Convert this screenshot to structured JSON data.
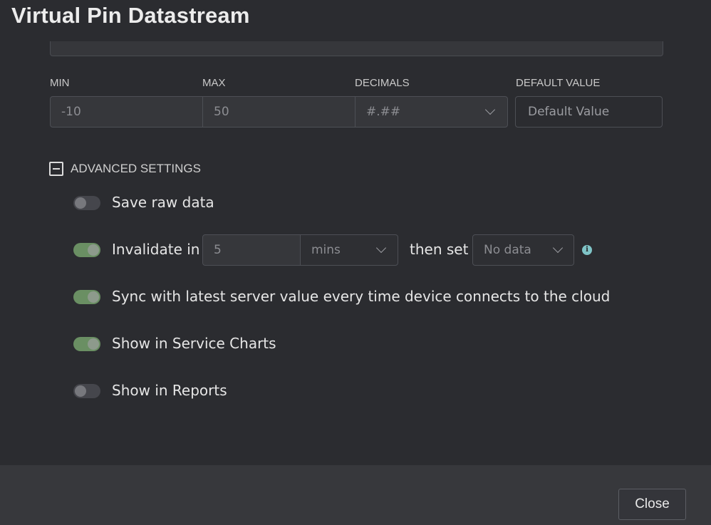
{
  "dialog": {
    "title": "Virtual Pin Datastream"
  },
  "fields": {
    "min": {
      "label": "MIN",
      "value": "-10"
    },
    "max": {
      "label": "MAX",
      "value": "50"
    },
    "decimals": {
      "label": "DECIMALS",
      "value": "#.##"
    },
    "default_value": {
      "label": "DEFAULT VALUE",
      "placeholder": "Default Value"
    }
  },
  "advanced": {
    "label": "ADVANCED SETTINGS",
    "expanded": true,
    "save_raw_data": {
      "label": "Save raw data",
      "enabled": false
    },
    "invalidate": {
      "enabled": true,
      "label": "Invalidate in",
      "value": "5",
      "unit": "mins",
      "then_set_label": "then set",
      "then_set_value": "No data",
      "info_icon": "info-icon"
    },
    "sync": {
      "label": "Sync with latest server value every time device connects to the cloud",
      "enabled": true
    },
    "service_charts": {
      "label": "Show in Service Charts",
      "enabled": true
    },
    "reports": {
      "label": "Show in Reports",
      "enabled": false
    }
  },
  "footer": {
    "close_label": "Close"
  },
  "colors": {
    "background": "#2b2c30",
    "toggle_on": "#6a8f63",
    "info_accent": "#7fc4c7"
  }
}
